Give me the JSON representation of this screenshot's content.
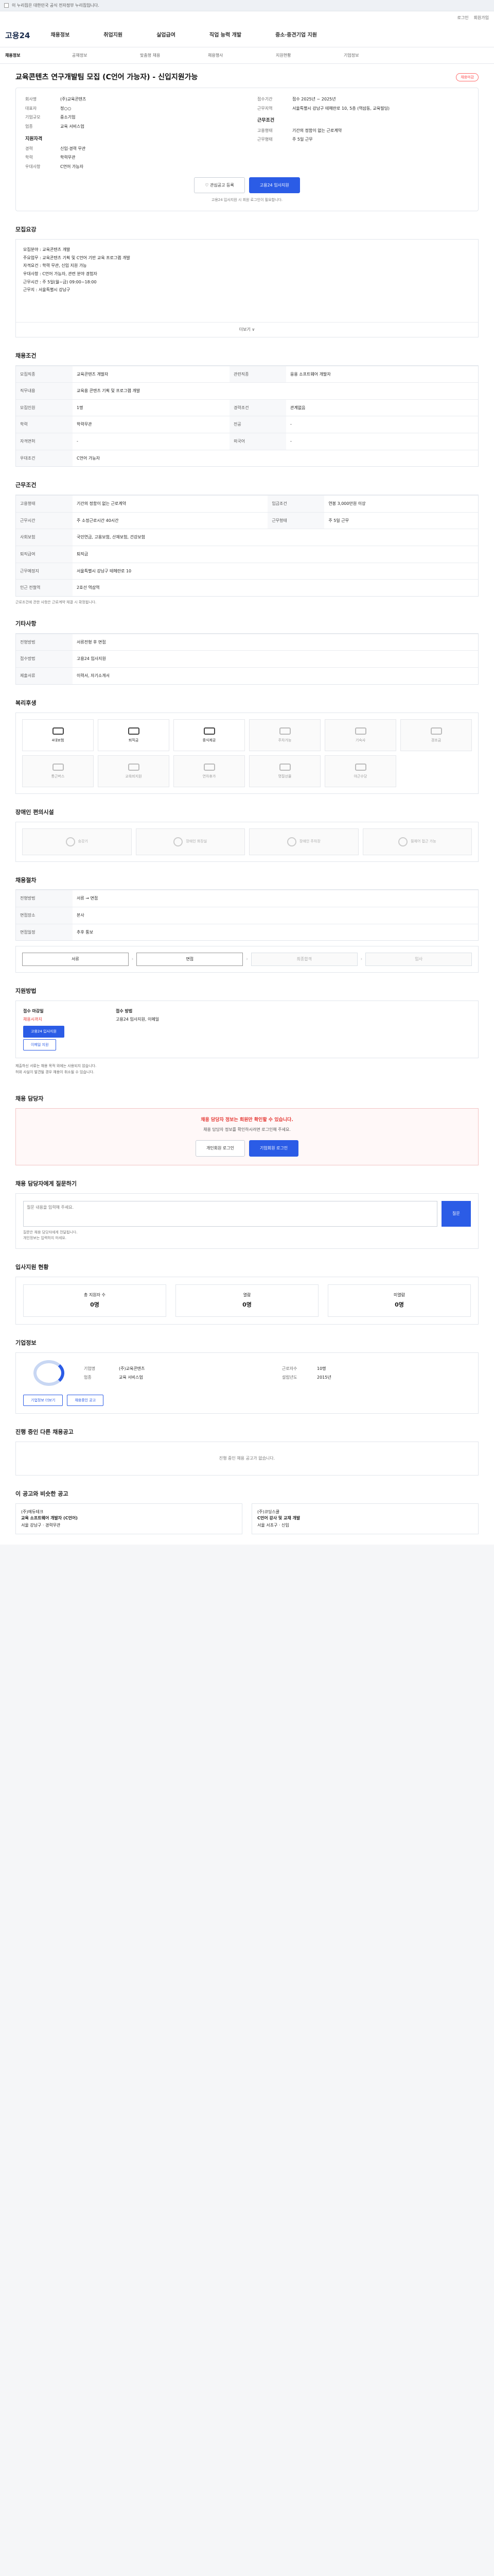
{
  "topbar": {
    "text": "이 누리집은 대한민국 공식 전자정부 누리집입니다."
  },
  "toolbar": {
    "login": "로그인",
    "join": "회원가입"
  },
  "header": {
    "logo": "고용24",
    "nav": [
      "채용정보",
      "취업지원",
      "실업급여",
      "직업 능력 개발",
      "중소·중견기업 지원"
    ]
  },
  "subnav": {
    "active": "채용정보",
    "items": [
      "공채정보",
      "맞춤형 채용",
      "채용행사",
      "지원현황",
      "기업정보"
    ]
  },
  "job": {
    "title": "교육콘텐츠 연구개발팀 모집 (C언어 가능자) - 신입지원가능",
    "badge": "채용마감",
    "company_label": "회사명",
    "company": "(주)교육콘텐츠",
    "ceo_label": "대표자",
    "ceo": "정○○",
    "size_label": "기업규모",
    "size": "중소기업",
    "industry_label": "업종",
    "industry": "교육 서비스업",
    "period_label": "접수기간",
    "period": "접수 2025년 ~ 2025년",
    "loc_label": "근무지역",
    "loc": "서울특별시 강남구 테헤란로 10, 5층 (역삼동, 교육빌딩)",
    "cond_title": "지원자격",
    "cond_rows": [
      [
        "경력",
        "신입·경력 무관"
      ],
      [
        "학력",
        "학력무관"
      ],
      [
        "우대사항",
        "C언어 가능자"
      ]
    ],
    "work_title": "근무조건",
    "work_rows": [
      [
        "고용형태",
        "기간의 정함이 없는 근로계약"
      ],
      [
        "근무형태",
        "주 5일 근무"
      ]
    ],
    "btn_scrap": "관심공고 등록",
    "btn_apply": "고용24 입사지원",
    "apply_note": "고용24 입사지원 시 회원 로그인이 필요합니다."
  },
  "sections": {
    "summary": "모집요강",
    "summary_text": [
      "모집분야 : 교육콘텐츠 개발",
      "주요업무 : 교육콘텐츠 기획 및 C언어 기반 교육 프로그램 개발",
      "자격요건 : 학력 무관, 신입 지원 가능",
      "우대사항 : C언어 가능자, 관련 분야 경험자",
      "근무시간 : 주 5일(월~금) 09:00~18:00",
      "근무지 : 서울특별시 강남구"
    ],
    "more": "더보기 ∨",
    "recruit": "채용조건",
    "recruit_rows": [
      [
        "모집직종",
        "교육콘텐츠 개발자"
      ],
      [
        "관련직종",
        "응용 소프트웨어 개발자"
      ],
      [
        "직무내용",
        "교육용 콘텐츠 기획 및 프로그램 개발"
      ],
      [
        "모집인원",
        "1명"
      ],
      [
        "경력조건",
        "관계없음"
      ],
      [
        "학력",
        "학력무관"
      ],
      [
        "전공",
        "-"
      ],
      [
        "자격면허",
        "-"
      ],
      [
        "외국어",
        "-"
      ],
      [
        "우대조건",
        "C언어 가능자"
      ]
    ],
    "work": "근무조건",
    "work_rows": [
      [
        "고용형태",
        "기간의 정함이 없는 근로계약"
      ],
      [
        "임금조건",
        "연봉 3,000만원 이상"
      ],
      [
        "근무시간",
        "주 소정근로시간 40시간"
      ],
      [
        "근무형태",
        "주 5일 근무"
      ],
      [
        "사회보험",
        "국민연금, 고용보험, 산재보험, 건강보험"
      ],
      [
        "퇴직급여",
        "퇴직금"
      ],
      [
        "근무예정지",
        "서울특별시 강남구 테헤란로 10"
      ],
      [
        "인근 전철역",
        "2호선 역삼역"
      ]
    ],
    "work_note": "근로조건에 관한 사항은 근로계약 체결 시 확정됩니다.",
    "etc": "기타사항",
    "etc_rows": [
      [
        "전형방법",
        "서류전형 후 면접"
      ],
      [
        "접수방법",
        "고용24 입사지원"
      ],
      [
        "제출서류",
        "이력서, 자기소개서"
      ]
    ],
    "welfare": "복리후생",
    "welfare_items": [
      "4대보험",
      "퇴직금",
      "중식제공",
      "주차가능",
      "기숙사",
      "경조금",
      "통근버스",
      "교육비지원",
      "연차휴가",
      "명절선물",
      "야근수당"
    ],
    "welfare_on": [
      0,
      1,
      2
    ],
    "disabled": "장애인 편의시설",
    "disabled_items": [
      "승강기",
      "장애인 화장실",
      "장애인 주차장",
      "휠체어 접근 가능"
    ],
    "process": "채용절차",
    "process_rows": [
      [
        "전형방법",
        "서류 → 면접"
      ],
      [
        "면접장소",
        "본사"
      ],
      [
        "면접일정",
        "추후 통보"
      ]
    ],
    "steps": [
      "서류",
      "면접",
      "최종합격",
      "입사"
    ],
    "apply": "지원방법",
    "apply_left": "접수 마감일",
    "apply_left_val": "채용시까지",
    "apply_right": "접수 방법",
    "apply_right_val": "고용24 입사지원, 이메일",
    "apply_btn1": "고용24 입사지원",
    "apply_btn2": "이메일 지원",
    "apply_bullets": [
      "제출하신 서류는 채용 목적 외에는 사용되지 않습니다.",
      "허위 사실이 발견될 경우 채용이 취소될 수 있습니다."
    ],
    "contact": "채용 담당자",
    "contact_warn": "채용 담당자 정보는 회원만 확인할 수 있습니다.",
    "contact_text": "채용 담당자 정보를 확인하시려면 로그인해 주세요.",
    "contact_btn1": "개인회원 로그인",
    "contact_btn2": "기업회원 로그인",
    "qa": "채용 담당자에게 질문하기",
    "qa_placeholder": "질문 내용을 입력해 주세요.",
    "qa_send": "질문",
    "qa_notes": [
      "질문은 채용 담당자에게 전달됩니다.",
      "개인정보는 입력하지 마세요."
    ],
    "applicants": "입사지원 현황",
    "stats": [
      [
        "총 지원자 수",
        "0명"
      ],
      [
        "열람",
        "0명"
      ],
      [
        "미열람",
        "0명"
      ]
    ],
    "company": "기업정보",
    "company_rows": [
      [
        "기업명",
        "(주)교육콘텐츠"
      ],
      [
        "업종",
        "교육 서비스업"
      ],
      [
        "근로자수",
        "10명"
      ],
      [
        "설립년도",
        "2015년"
      ]
    ],
    "company_btns": [
      "기업정보 더보기",
      "채용중인 공고"
    ],
    "similar": "진행 중인 다른 채용공고",
    "similar_empty": "진행 중인 채용 공고가 없습니다.",
    "recommend": "이 공고와 비슷한 공고",
    "jobs": [
      [
        "(주)에듀테크",
        "교육 소프트웨어 개발자 (C언어)",
        "서울 강남구 · 경력무관"
      ],
      [
        "(주)코딩스쿨",
        "C언어 강사 및 교재 개발",
        "서울 서초구 · 신입"
      ]
    ]
  }
}
